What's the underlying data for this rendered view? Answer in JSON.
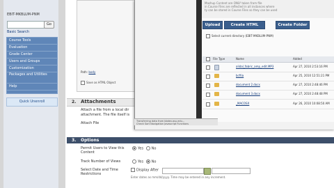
{
  "sidebar": {
    "course_id": "EBIT-MKBLUM-PNM",
    "search_go": "Go",
    "basic_search": "Basic Search",
    "menu": [
      "Course Tools",
      "Evaluation",
      "Grade Center",
      "Users and Groups",
      "Customization",
      "Packages and Utilities",
      "Help"
    ],
    "quick_unenroll": "Quick Unenroll"
  },
  "editor": {
    "path_label": "Path:",
    "path_link": "body",
    "save_html_object": "Save as HTML Object"
  },
  "attachments": {
    "number": "2.",
    "title": "Attachments",
    "desc_line1": "Attach a file from a local dir",
    "desc_line2": "attachment. The file itself is",
    "attach_file_label": "Attach File"
  },
  "options": {
    "number": "3.",
    "title": "Options",
    "permit_label_1": "Permit Users to View this",
    "permit_label_2": "Content",
    "track_label": "Track Number of Views",
    "yes": "Yes",
    "no": "No",
    "permit_selected": "Yes",
    "track_selected": "No",
    "date_label_1": "Select Date and Time",
    "date_label_2": "Restrictions",
    "display_after": "Display After",
    "date_note": "Enter dates as mm/dd/yyyy. Time may be entered in any increment."
  },
  "popup": {
    "note_line1": "Mashup Content are ONLY taken from file",
    "note_line2": "in Course Files are reflected in all instances where",
    "note_line3": "ty can be stored in Course Files so they can be used",
    "toolbar": {
      "upload": "Upload",
      "create_html": "Create HTML Object",
      "create_folder": "Create Folder"
    },
    "select_current": "Select current directory (EBIT-MKBLUM-PNM)",
    "columns": {
      "type": "File Type",
      "name": "Name",
      "added": "Added"
    },
    "files": [
      {
        "type": "doc",
        "name": "alidal_fabric_amp_edit.MP3",
        "date": "Apr 27, 2010 2:53:16 PM"
      },
      {
        "type": "folder",
        "name": "bcftia",
        "date": "Apr 25, 2010 12:51:21 PM"
      },
      {
        "type": "folder",
        "name": "document 2.docx",
        "date": "Apr 27, 2010 2:48:46 PM"
      },
      {
        "type": "folder",
        "name": "document 3.docx",
        "date": "Apr 27, 2010 2:48:48 PM"
      },
      {
        "type": "folder",
        "name": "_MACOSX",
        "date": "Apr 26, 2010 10:08:50 AM"
      }
    ],
    "status_line1": "Transferring data from bbdev.asu.edu...",
    "status_line2": "Check Sort Navigation  Javascript Functions"
  }
}
